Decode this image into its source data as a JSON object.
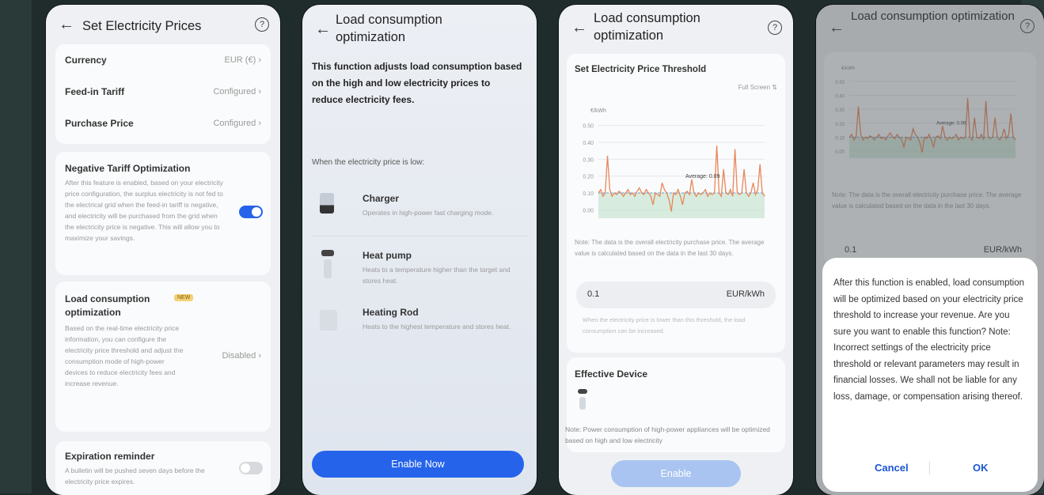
{
  "screen1": {
    "title": "Set Electricity Prices",
    "back_icon": "back-arrow-icon",
    "help_icon": "help-circle-icon",
    "rows": [
      {
        "label": "Currency",
        "value": "EUR (€)"
      },
      {
        "label": "Feed-in Tariff",
        "value": "Configured"
      },
      {
        "label": "Purchase Price",
        "value": "Configured"
      }
    ],
    "negative_tariff": {
      "title": "Negative Tariff Optimization",
      "desc": "After this feature is enabled, based on your electricity price configuration, the surplus electricity is not fed to the electrical grid when the feed-in tariff is negative, and electricity will be purchased from the grid when the electricity price is negative. This will allow you to maximize your savings.",
      "enabled": true
    },
    "load_opt": {
      "title": "Load consumption optimization",
      "badge": "NEW",
      "desc": "Based on the real-time electricity price information, you can configure the electricity price threshold and adjust the consumption mode of high-power devices to reduce electricity fees and increase revenue.",
      "value": "Disabled"
    },
    "expiration": {
      "title": "Expiration reminder",
      "desc": "A bulletin will be pushed seven days before the electricity price expires.",
      "enabled": false
    }
  },
  "screen2": {
    "title": "Load consumption optimization",
    "intro": "This function adjusts load consumption based on the high and low electricity prices to reduce electricity fees.",
    "when_low": "When the electricity price is low:",
    "devices": [
      {
        "name": "Charger",
        "desc": "Operates in high-power fast charging mode.",
        "icon": "charger-icon"
      },
      {
        "name": "Heat pump",
        "desc": "Heats to a temperature higher than the target and stores heat.",
        "icon": "heat-pump-icon"
      },
      {
        "name": "Heating Rod",
        "desc": "Heats to the highest temperature and stores heat.",
        "icon": "heating-rod-icon"
      }
    ],
    "enable_button": "Enable Now"
  },
  "screen3": {
    "title": "Load consumption optimization",
    "section_title": "Set Electricity Price Threshold",
    "view_selector": "Full Screen",
    "chart_note": "Note: The data is the overall electricity purchase price. The average value is calculated based on the data in the last 30 days.",
    "threshold_value": "0.1",
    "threshold_unit": "EUR/kWh",
    "threshold_hint": "When the electricity price is lower than this threshold, the load consumption can be increased.",
    "effective_title": "Effective Device",
    "bottom_note": "Note: Power consumption of high-power appliances will be optimized based on high and low electricity",
    "enable_button": "Enable"
  },
  "screen4": {
    "title": "Load consumption optimization",
    "chart_note": "Note: The data is the overall electricity purchase price. The average value is calculated based on the data in the last 30 days.",
    "threshold_value": "0.1",
    "threshold_unit": "EUR/kWh",
    "dialog_text": "After this function is enabled, load consumption will be optimized based on your electricity price threshold to increase your revenue. Are you sure you want to enable this function? Note: Incorrect settings of the electricity price threshold or relevant parameters may result in financial losses. We shall not be liable for any loss, damage, or compensation arising thereof.",
    "cancel": "Cancel",
    "ok": "OK"
  },
  "colors": {
    "accent": "#2563eb",
    "accent_disabled": "#a9c4f1",
    "series": "#e8875a",
    "avg_line": "#6a9bd8",
    "threshold_band": "#bfe3c9"
  },
  "chart_data": {
    "type": "line",
    "ylabel": "€/kWh",
    "y_ticks": [
      "0.50",
      "0.40",
      "0.30",
      "0.20",
      "0.10",
      "0.00"
    ],
    "ylim": [
      -0.05,
      0.55
    ],
    "average_label": "Average: 0.09",
    "threshold": 0.1,
    "series": [
      {
        "values": [
          0.1,
          0.12,
          0.08,
          0.1,
          0.32,
          0.12,
          0.08,
          0.1,
          0.09,
          0.11,
          0.1,
          0.08,
          0.1,
          0.12,
          0.09,
          0.1,
          0.08,
          0.11,
          0.13,
          0.1,
          0.09,
          0.12,
          0.1,
          0.08,
          0.03,
          0.1,
          0.09,
          0.08,
          0.16,
          0.12,
          0.1,
          0.06,
          -0.01,
          0.1,
          0.09,
          0.12,
          0.08,
          0.03,
          0.1,
          0.11,
          0.09,
          0.18,
          0.1,
          0.08,
          0.1,
          0.09,
          0.1,
          0.12,
          0.08,
          0.1,
          0.09,
          0.1,
          0.38,
          0.1,
          0.08,
          0.24,
          0.1,
          0.09,
          0.12,
          0.08,
          0.36,
          0.1,
          0.09,
          0.1,
          0.24,
          0.1,
          0.08,
          0.1,
          0.16,
          0.09,
          0.12,
          0.27,
          0.1,
          0.08
        ]
      }
    ]
  }
}
